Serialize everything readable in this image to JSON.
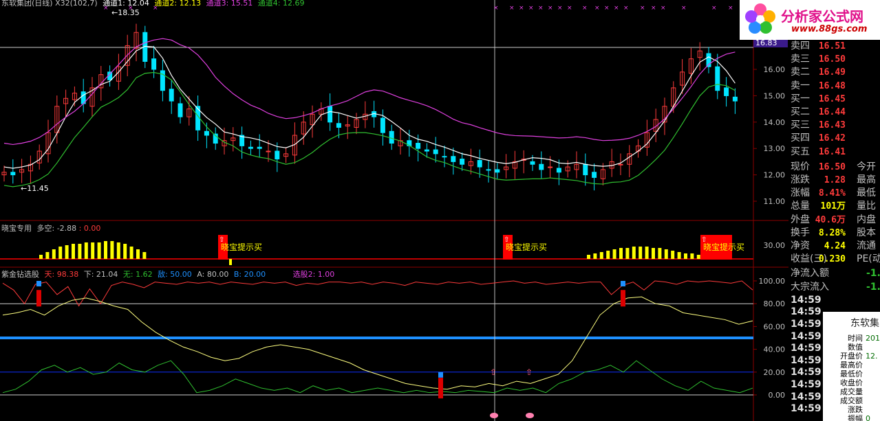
{
  "colors": {
    "up": "#ff3b3b",
    "down": "#00e5ff",
    "ma_white": "#ffffff",
    "ma_magenta": "#e040e0",
    "ma_green": "#30c030",
    "grid": "#8b0000",
    "yellow": "#ffff00",
    "blue": "#1e90ff"
  },
  "main_pane": {
    "title_segments": [
      {
        "text": "东软集团(日线) X32(102,7)",
        "color": "#c0c0c0"
      },
      {
        "text": "通道1: 12.04",
        "color": "#ffffff"
      },
      {
        "text": "通道2: 12.13",
        "color": "#ffff00"
      },
      {
        "text": "通道3: 15.51",
        "color": "#e040e0"
      },
      {
        "text": "通道4: 12.69",
        "color": "#30c030"
      }
    ],
    "price_ticks": [
      "16.00",
      "15.00",
      "14.00",
      "13.00",
      "12.00",
      "11.00"
    ],
    "high_label": "18.35",
    "low_label": "11.45",
    "current_price_label": "16.83"
  },
  "xb_pane": {
    "title": "晓宝专用",
    "title2": "多空: -2.88",
    "title3": ": 0.00",
    "tick": "30.00",
    "signal_label": "晓宝提示买"
  },
  "zj_pane": {
    "title_segments": [
      {
        "text": "紫金钻选股",
        "color": "#c0c0c0"
      },
      {
        "text": "天: 98.38",
        "color": "#ff3b3b"
      },
      {
        "text": "下: 21.04",
        "color": "#c0c0c0"
      },
      {
        "text": "无: 1.62",
        "color": "#30c030"
      },
      {
        "text": "敌: 50.00",
        "color": "#1e90ff"
      },
      {
        "text": "A: 80.00",
        "color": "#c0c0c0"
      },
      {
        "text": "B: 20.00",
        "color": "#1e90ff"
      },
      {
        "text": "选股2: 1.00",
        "color": "#e040e0"
      }
    ],
    "ticks": [
      "100.00",
      "80.00",
      "60.00",
      "40.00",
      "20.00",
      "0.00"
    ]
  },
  "logo": {
    "text": "分析家公式网",
    "url_text": "www.88gs.com"
  },
  "quote_panel": {
    "orders": [
      {
        "label": "卖四",
        "value": "16.51"
      },
      {
        "label": "卖三",
        "value": "16.50"
      },
      {
        "label": "卖二",
        "value": "16.49"
      },
      {
        "label": "卖一",
        "value": "16.48"
      },
      {
        "label": "买一",
        "value": "16.45"
      },
      {
        "label": "买二",
        "value": "16.44"
      },
      {
        "label": "买三",
        "value": "16.43"
      },
      {
        "label": "买四",
        "value": "16.42"
      },
      {
        "label": "买五",
        "value": "16.41"
      }
    ],
    "stats": [
      {
        "label": "现价",
        "value": "16.50",
        "label2": "今开",
        "color": "#ff3b3b"
      },
      {
        "label": "涨跌",
        "value": "1.28",
        "label2": "最高",
        "color": "#ff3b3b"
      },
      {
        "label": "涨幅",
        "value": "8.41%",
        "label2": "最低",
        "color": "#ff3b3b"
      },
      {
        "label": "总量",
        "value": "101万",
        "label2": "量比",
        "color": "#ffff00"
      },
      {
        "label": "外盘",
        "value": "40.6万",
        "label2": "内盘",
        "color": "#ff3b3b"
      },
      {
        "label": "换手",
        "value": "8.28%",
        "label2": "股本",
        "color": "#ffff00"
      },
      {
        "label": "净资",
        "value": "4.24",
        "label2": "流通",
        "color": "#ffff00"
      },
      {
        "label": "收益(三)",
        "value": "0.230",
        "label2": "PE(动",
        "color": "#ffff00"
      }
    ],
    "flows": [
      {
        "label": "净流入额",
        "value": "-1."
      },
      {
        "label": "大宗流入",
        "value": "-1."
      }
    ],
    "times": [
      "14:59",
      "14:59",
      "14:59",
      "14:59",
      "14:59",
      "14:59",
      "14:59",
      "14:59",
      "14:59",
      "14:59"
    ]
  },
  "popup": {
    "title": "东软集",
    "rows": [
      {
        "label": "时间",
        "value": "201"
      },
      {
        "label": "数值",
        "value": ""
      },
      {
        "label": "开盘价",
        "value": "12."
      },
      {
        "label": "最高价",
        "value": ""
      },
      {
        "label": "最低价",
        "value": ""
      },
      {
        "label": "收盘价",
        "value": ""
      },
      {
        "label": "成交量",
        "value": ""
      },
      {
        "label": "成交额",
        "value": ""
      },
      {
        "label": "涨跌",
        "value": ""
      },
      {
        "label": "振幅",
        "value": "0"
      }
    ]
  }
}
